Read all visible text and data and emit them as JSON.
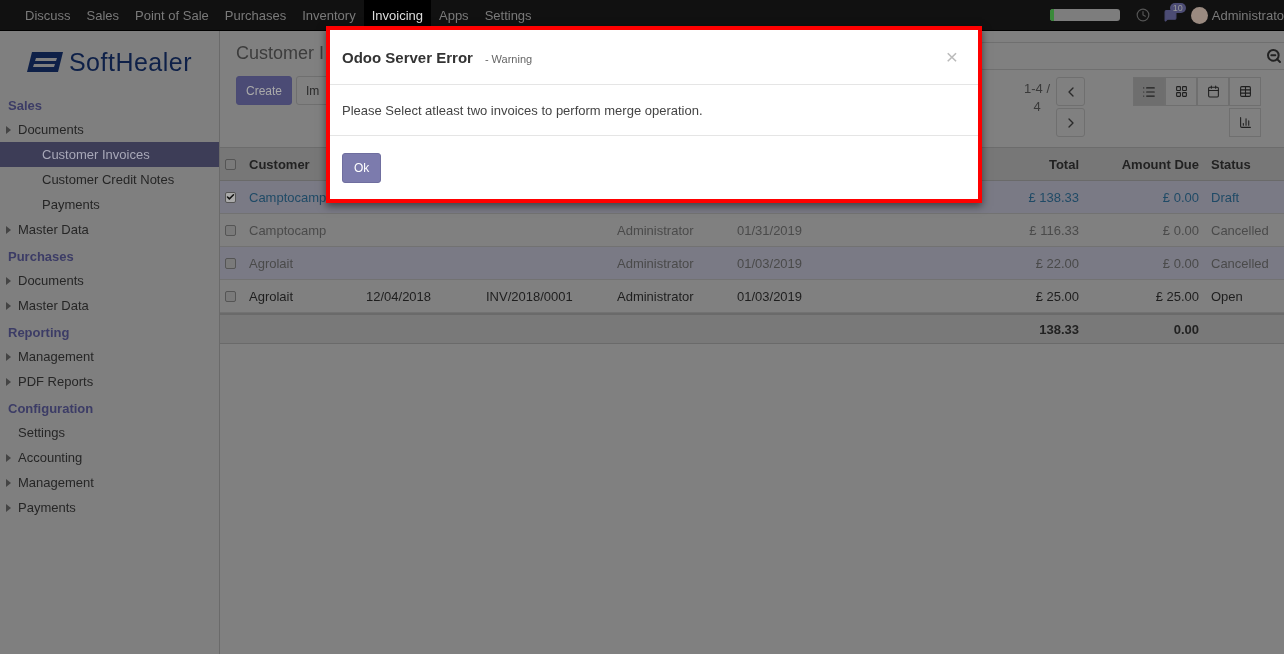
{
  "navbar": {
    "apps": [
      {
        "label": "Discuss",
        "selected": false
      },
      {
        "label": "Sales",
        "selected": false
      },
      {
        "label": "Point of Sale",
        "selected": false
      },
      {
        "label": "Purchases",
        "selected": false
      },
      {
        "label": "Inventory",
        "selected": false
      },
      {
        "label": "Invoicing",
        "selected": true
      },
      {
        "label": "Apps",
        "selected": false
      },
      {
        "label": "Settings",
        "selected": false
      }
    ],
    "progress": {
      "level": 0.06
    },
    "messages_badge": "10",
    "user": "Administrato"
  },
  "sidebar": {
    "logo": "SoftHealer",
    "sections": [
      {
        "heading": "Sales",
        "items": [
          {
            "label": "Documents",
            "caret": true,
            "selected": false,
            "children": [
              {
                "label": "Customer Invoices",
                "caret": false,
                "selected": true
              },
              {
                "label": "Customer Credit Notes",
                "caret": false,
                "selected": false
              },
              {
                "label": "Payments",
                "caret": false,
                "selected": false
              }
            ]
          },
          {
            "label": "Master Data",
            "caret": true,
            "selected": false
          }
        ]
      },
      {
        "heading": "Purchases",
        "items": [
          {
            "label": "Documents",
            "caret": true,
            "selected": false
          },
          {
            "label": "Master Data",
            "caret": true,
            "selected": false
          }
        ]
      },
      {
        "heading": "Reporting",
        "items": [
          {
            "label": "Management",
            "caret": true,
            "selected": false
          },
          {
            "label": "PDF Reports",
            "caret": true,
            "selected": false
          }
        ]
      },
      {
        "heading": "Configuration",
        "items": [
          {
            "label": "Settings",
            "caret": false,
            "selected": false
          },
          {
            "label": "Accounting",
            "caret": true,
            "selected": false
          },
          {
            "label": "Management",
            "caret": true,
            "selected": false
          },
          {
            "label": "Payments",
            "caret": true,
            "selected": false
          }
        ]
      }
    ]
  },
  "control_panel": {
    "title": "Customer I",
    "buttons": [
      {
        "label": "Create",
        "kind": "primary"
      },
      {
        "label": "Im",
        "kind": "secondary"
      }
    ],
    "pager": "1-4 / 4",
    "views": [
      {
        "kind": "list",
        "selected": true
      },
      {
        "kind": "kanban",
        "selected": false
      },
      {
        "kind": "calendar",
        "selected": false
      },
      {
        "kind": "pivot",
        "selected": false
      },
      {
        "kind": "graph",
        "selected": false
      }
    ]
  },
  "table": {
    "header_checked": false,
    "columns": {
      "customer": "Customer",
      "total": "Total",
      "amount_due": "Amount Due",
      "status": "Status"
    },
    "rows": [
      {
        "checked": true,
        "kind": "draft",
        "customer": "Camptocamp",
        "total": "£ 138.33",
        "amount_due": "£ 0.00",
        "status": "Draft"
      },
      {
        "checked": false,
        "kind": "cancelled",
        "customer": "Camptocamp",
        "salesperson": "Administrator",
        "due_date": "01/31/2019",
        "total": "£ 116.33",
        "amount_due": "£ 0.00",
        "status": "Cancelled"
      },
      {
        "checked": false,
        "kind": "cancelled",
        "customer": "Agrolait",
        "salesperson": "Administrator",
        "due_date": "01/03/2019",
        "total": "£ 22.00",
        "amount_due": "£ 0.00",
        "status": "Cancelled"
      },
      {
        "checked": false,
        "kind": "open",
        "customer": "Agrolait",
        "invoice_date": "12/04/2018",
        "number": "INV/2018/0001",
        "salesperson": "Administrator",
        "due_date": "01/03/2019",
        "total": "£ 25.00",
        "amount_due": "£ 25.00",
        "status": "Open"
      }
    ],
    "footer": {
      "total": "138.33",
      "amount_due": "0.00"
    }
  },
  "dialog": {
    "title": "Odoo Server Error",
    "subtitle": "- Warning",
    "close": "×",
    "message": "Please Select atleast two invoices to perform merge operation.",
    "button": "Ok"
  }
}
